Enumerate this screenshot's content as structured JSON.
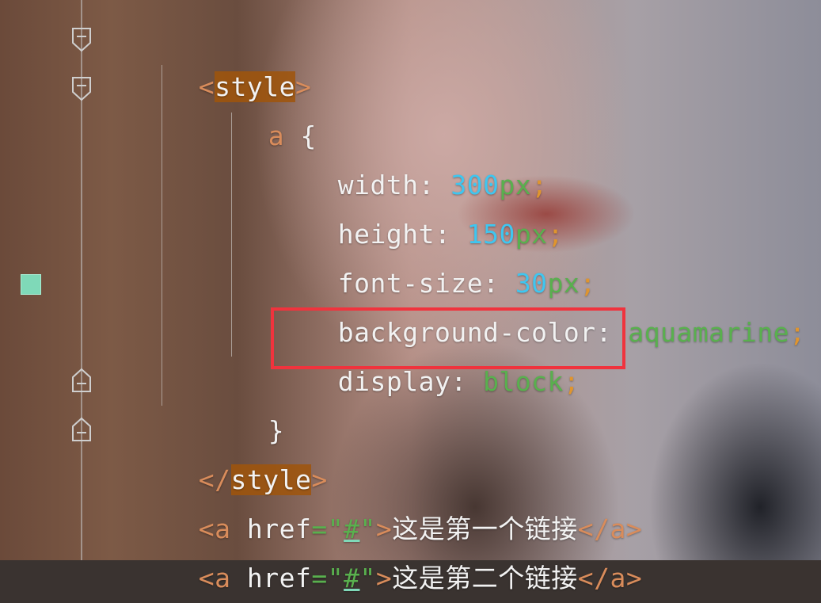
{
  "editor": {
    "lines": [
      {
        "open": "<",
        "tag": "style",
        "close": ">"
      },
      {
        "selector": "a",
        "brace": "{"
      },
      {
        "prop": "width",
        "colon": ":",
        "num": "300",
        "unit": "px",
        "semi": ";"
      },
      {
        "prop": "height",
        "colon": ":",
        "num": "150",
        "unit": "px",
        "semi": ";"
      },
      {
        "prop": "font-size",
        "colon": ":",
        "num": "30",
        "unit": "px",
        "semi": ";"
      },
      {
        "prop": "background-color",
        "colon": ":",
        "value": "aquamarine",
        "semi": ";"
      },
      {
        "prop": "display",
        "colon": ":",
        "value": "block",
        "semi": ";"
      },
      {
        "brace": "}"
      },
      {
        "open": "</",
        "tag": "style",
        "close": ">"
      },
      {
        "open": "<a",
        "attr": "href",
        "eq": "=",
        "q1": "\"",
        "href": "#",
        "q2": "\"",
        "gt": ">",
        "text": "这是第一个链接",
        "end": "</a>"
      },
      {
        "open": "<a",
        "attr": "href",
        "eq": "=",
        "q1": "\"",
        "href": "#",
        "q2": "\"",
        "gt": ">",
        "text": "这是第二个链接",
        "end": "</a>"
      }
    ],
    "color_swatch": "#7fffd4",
    "highlight_color": "#f0333d"
  }
}
